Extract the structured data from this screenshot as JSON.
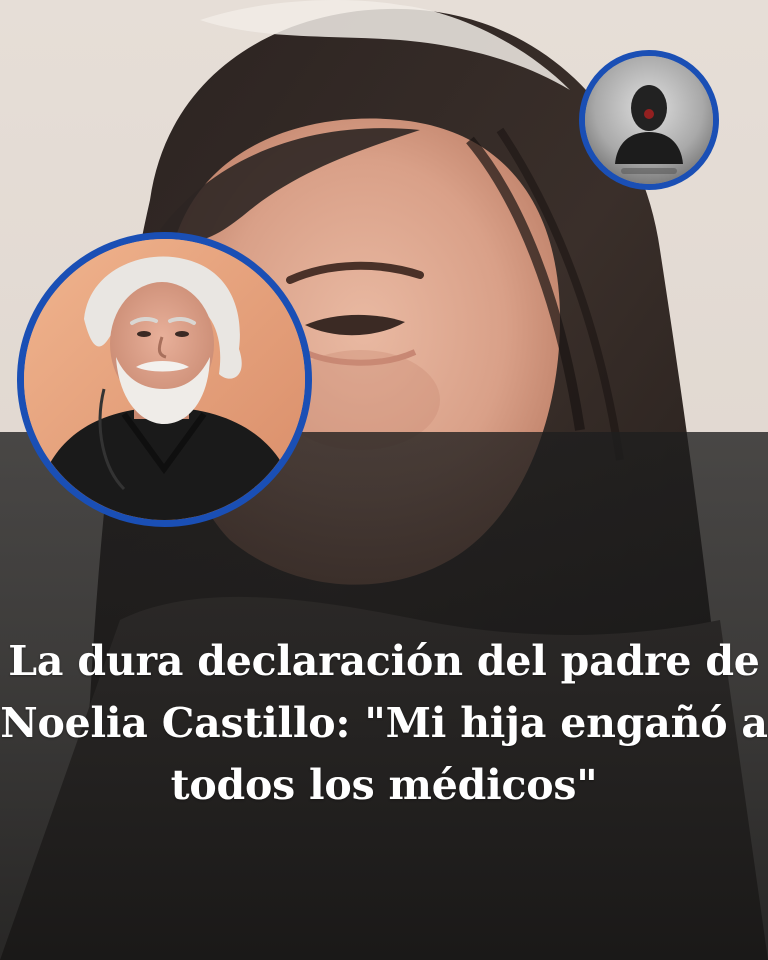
{
  "headline": {
    "line1": "La dura declaración del padre de",
    "line2": "Noelia Castillo: \"Mi hija engañó a",
    "line3": "todos los médicos\""
  },
  "images": {
    "background": "woman-portrait-photo",
    "inset_large": "father-portrait-photo",
    "inset_small": "anonymous-person-silhouette"
  },
  "colors": {
    "circle_border": "#1a4fb5",
    "headline_text": "#ffffff",
    "overlay": "#1e1e1e"
  }
}
